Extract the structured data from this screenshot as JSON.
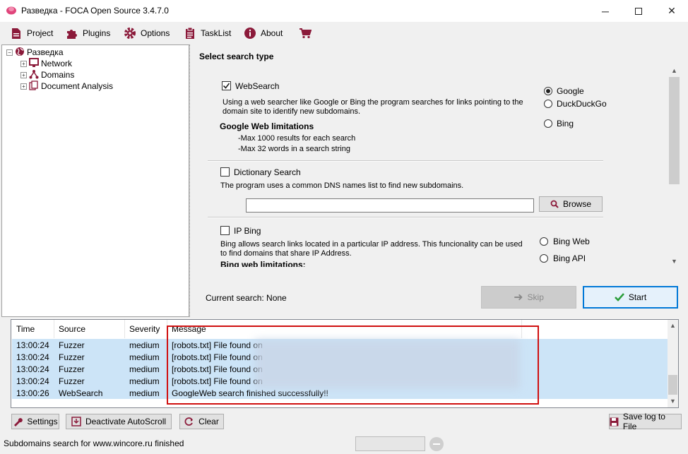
{
  "window": {
    "title": "Разведка - FOCA Open Source 3.4.7.0"
  },
  "menu": {
    "project": "Project",
    "plugins": "Plugins",
    "options": "Options",
    "tasklist": "TaskList",
    "about": "About"
  },
  "tree": {
    "root": "Разведка",
    "children": [
      "Network",
      "Domains",
      "Document Analysis"
    ]
  },
  "search": {
    "heading": "Select search type",
    "websearch": {
      "label": "WebSearch",
      "checked": true,
      "desc1": "Using a web searcher like Google or Bing the program searches for links pointing to the",
      "desc2": "domain site to identify new subdomains.",
      "limits_title": "Google Web  limitations",
      "limit1": "-Max 1000 results for each search",
      "limit2": "-Max 32 words in a search string",
      "engines": [
        "Google",
        "DuckDuckGo",
        "Bing"
      ],
      "selected_engine": "Google"
    },
    "dictionary": {
      "label": "Dictionary Search",
      "checked": false,
      "desc": "The program uses a common DNS names list to find new subdomains.",
      "path_value": "",
      "browse": "Browse"
    },
    "ipbing": {
      "label": "IP Bing",
      "checked": false,
      "desc1": "Bing allows search links located in a particular IP address. This funcionality can be used",
      "desc2": "to find domains that share IP Address.",
      "limits_title": "Bing web limitations:",
      "options": [
        "Bing Web",
        "Bing API"
      ]
    },
    "current_search": "Current search: None",
    "skip": "Skip",
    "start": "Start"
  },
  "log": {
    "columns": [
      "Time",
      "Source",
      "Severity",
      "Message"
    ],
    "rows": [
      {
        "time": "13:00:24",
        "source": "Fuzzer",
        "severity": "medium",
        "message": "[robots.txt] File found on"
      },
      {
        "time": "13:00:24",
        "source": "Fuzzer",
        "severity": "medium",
        "message": "[robots.txt] File found on"
      },
      {
        "time": "13:00:24",
        "source": "Fuzzer",
        "severity": "medium",
        "message": "[robots.txt] File found on"
      },
      {
        "time": "13:00:24",
        "source": "Fuzzer",
        "severity": "medium",
        "message": "[robots.txt] File found on"
      },
      {
        "time": "13:00:26",
        "source": "WebSearch",
        "severity": "medium",
        "message": "GoogleWeb search finished successfully!!"
      }
    ]
  },
  "buttons": {
    "settings": "Settings",
    "autoscroll": "Deactivate AutoScroll",
    "clear": "Clear",
    "save_log": "Save log to File"
  },
  "status": {
    "text": "Subdomains search for www.wincore.ru finished"
  },
  "colors": {
    "row_highlight": "#cce4f7",
    "annotation_box": "#d01010",
    "start_border": "#0078d7",
    "brand_pink": "#e0457b"
  }
}
